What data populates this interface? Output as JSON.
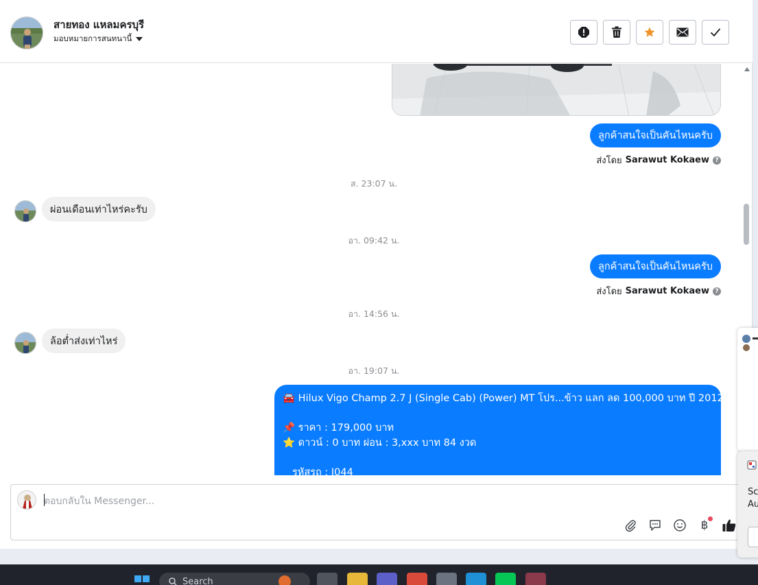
{
  "header": {
    "name": "สายทอง แหลมครบุรี",
    "assign_label": "มอบหมายการสนทนานี้"
  },
  "messages": {
    "out1": "ลูกค้าสนใจเป็นคันไหนครับ",
    "sent_by_prefix": "ส่งโดย",
    "sent_by_name": "Sarawut Kokaew",
    "ts1": "ส. 23:07 น.",
    "in1": "ผ่อนเดือนเท่าไหร่คะรับ",
    "ts2": "อา. 09:42 น.",
    "out2": "ลูกค้าสนใจเป็นคันไหนครับ",
    "ts3": "อา. 14:56 น.",
    "in2": "ล้อต่ำส่งเท่าไหร่",
    "ts4": "อา. 19:07 น.",
    "big": {
      "line1": "🚘 Hilux Vigo Champ 2.7 J (Single Cab) (Power) MT โปร...ข้าว แลก ลด 100,000 บาท ปี 2012",
      "line2": "📌 ราคา : 179,000 บาท",
      "line3": "⭐ ดาวน์ : 0 บาท ผ่อน : 3,xxx บาท 84 งวด",
      "line4": "รหัสรถ : J044"
    }
  },
  "composer": {
    "placeholder": "ตอบกลับใน Messenger..."
  },
  "popup": {
    "line1": "Sc",
    "line2": "Au"
  },
  "taskbar": {
    "search_label": "Search"
  },
  "colors": {
    "accent": "#0a7cff",
    "star": "#f0932b"
  }
}
